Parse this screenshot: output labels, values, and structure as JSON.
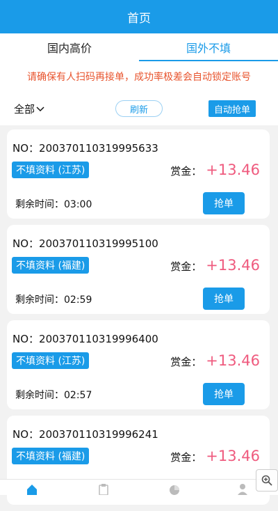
{
  "header": {
    "title": "首页"
  },
  "tabs": [
    {
      "label": "国内高价",
      "active": false
    },
    {
      "label": "国外不填",
      "active": true
    }
  ],
  "notice": "请确保有人扫码再接单，成功率极差会自动锁定账号",
  "filter": {
    "all_label": "全部",
    "refresh_label": "刷新",
    "auto_label": "自动抢单"
  },
  "orders": [
    {
      "no": "NO：200370110319995633",
      "tag": "不填资料 (江苏)",
      "bounty_label": "赏金：",
      "bounty": "+13.46",
      "time_left": "剩余时间：03:00",
      "grab_label": "抢单"
    },
    {
      "no": "NO：200370110319995100",
      "tag": "不填资料 (福建)",
      "bounty_label": "赏金：",
      "bounty": "+13.46",
      "time_left": "剩余时间：02:59",
      "grab_label": "抢单"
    },
    {
      "no": "NO：200370110319996400",
      "tag": "不填资料 (江苏)",
      "bounty_label": "赏金：",
      "bounty": "+13.46",
      "time_left": "剩余时间：02:57",
      "grab_label": "抢单"
    },
    {
      "no": "NO：200370110319996241",
      "tag": "不填资料 (福建)",
      "bounty_label": "赏金：",
      "bounty": "+13.46",
      "time_left": "",
      "grab_label": ""
    }
  ],
  "colors": {
    "primary": "#1a9be8",
    "notice": "#e8542e",
    "bounty": "#ef5a7e"
  },
  "icons": [
    "home-icon",
    "clipboard-icon",
    "pie-chart-icon",
    "user-icon",
    "zoom-icon"
  ]
}
